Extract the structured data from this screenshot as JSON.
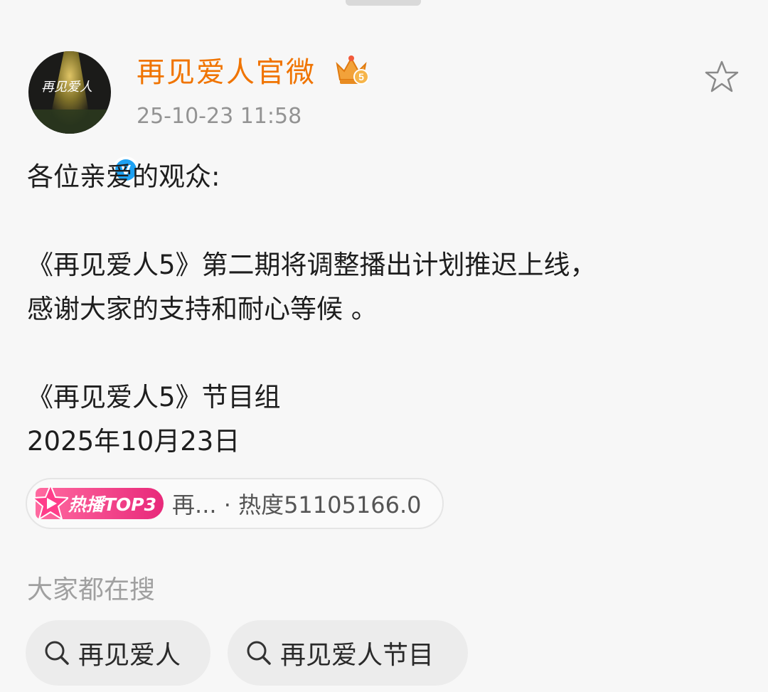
{
  "post": {
    "author": "再见爱人官微",
    "timestamp": "25-10-23 11:58",
    "vip_level": "5",
    "verified_mark": "V",
    "avatar_text": "再见爱人",
    "lines": [
      "各位亲爱的观众:",
      "",
      "《再见爱人5》第二期将调整播出计划推迟上线，",
      "感谢大家的支持和耐心等候 。",
      "",
      "《再见爱人5》节目组",
      "2025年10月23日"
    ]
  },
  "hot_tag": {
    "badge": "热播TOP3",
    "text": "再... · 热度51105166.0"
  },
  "search_section": {
    "label": "大家都在搜",
    "chips": [
      "再见爱人",
      "再见爱人节目"
    ]
  },
  "colors": {
    "username": "#f07400",
    "verified": "#1da1f2",
    "badge_gradient": [
      "#ff6aa0",
      "#e8297a"
    ]
  }
}
